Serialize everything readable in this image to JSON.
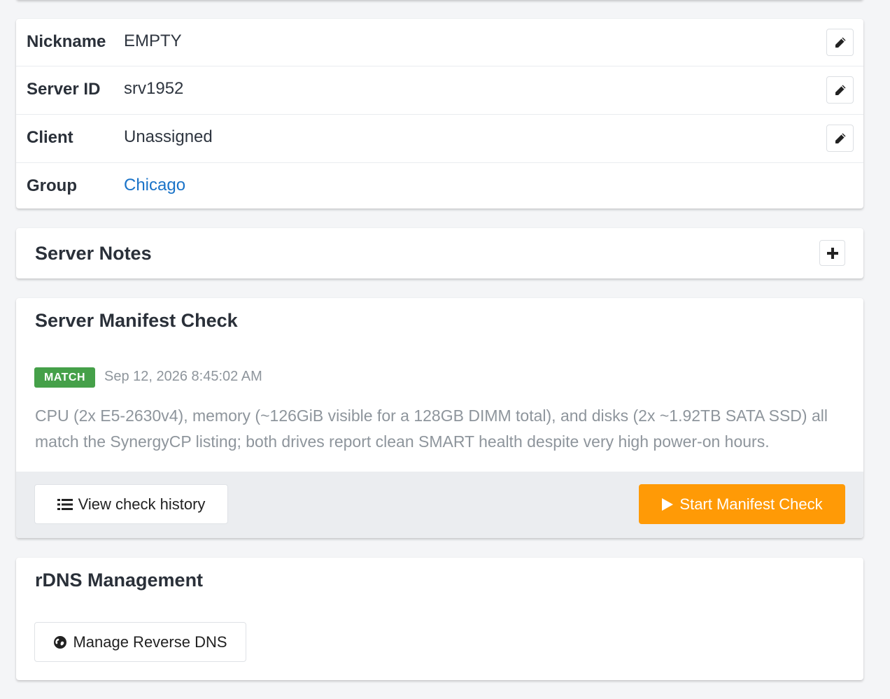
{
  "server_info": {
    "rows": [
      {
        "label": "Nickname",
        "value": "EMPTY",
        "editable": true
      },
      {
        "label": "Server ID",
        "value": "srv1952",
        "editable": true
      },
      {
        "label": "Client",
        "value": "Unassigned",
        "editable": true
      },
      {
        "label": "Group",
        "value": "Chicago",
        "editable": false,
        "link": true
      }
    ]
  },
  "server_notes": {
    "title": "Server Notes",
    "add_icon": "plus-icon"
  },
  "manifest_check": {
    "title": "Server Manifest Check",
    "status_badge": "MATCH",
    "status_color": "#45a049",
    "timestamp": "Sep 12, 2026 8:45:02 AM",
    "summary": "CPU (2x E5-2630v4), memory (~126GiB visible for a 128GB DIMM total), and disks (2x ~1.92TB SATA SSD) all match the SynergyCP listing; both drives report clean SMART health despite very high power-on hours.",
    "history_button": "View check history",
    "history_icon": "list-icon",
    "start_button": "Start Manifest Check",
    "start_icon": "play-icon",
    "accent_color": "#ff9a06"
  },
  "rdns": {
    "title": "rDNS Management",
    "manage_button": "Manage Reverse DNS",
    "manage_icon": "globe-icon"
  },
  "colors": {
    "link": "#1a73c8",
    "background": "#f4f5f7"
  }
}
